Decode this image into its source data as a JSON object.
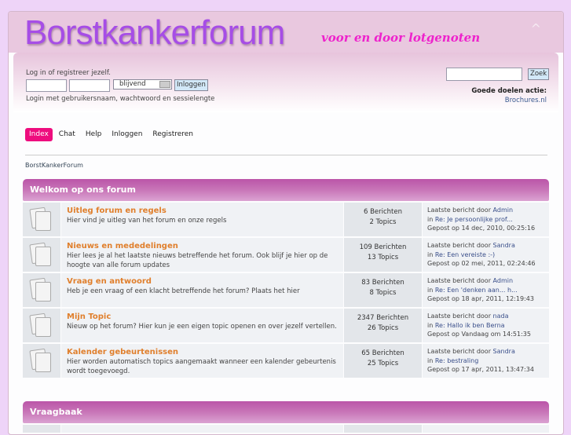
{
  "header": {
    "logo": "Borstkankerforum",
    "slogan": "voor en door lotgenoten"
  },
  "login": {
    "prompt": "Log in of registreer jezelf.",
    "session_option": "blijvend",
    "login_button": "Inloggen",
    "help": "Login met gebruikersnaam, wachtwoord en sessielengte"
  },
  "search": {
    "button": "Zoek",
    "charity_label": "Goede doelen actie:",
    "charity_link": "Brochures.nl"
  },
  "nav": [
    "Index",
    "Chat",
    "Help",
    "Inloggen",
    "Registreren"
  ],
  "breadcrumb": "BorstKankerForum",
  "categories": [
    {
      "title": "Welkom op ons forum",
      "boards": [
        {
          "name": "Uitleg forum en regels",
          "desc": "Hier vind je uitleg van het forum en onze regels",
          "posts": "6 Berichten",
          "topics": "2 Topics",
          "last_by_label": "Laatste bericht door",
          "last_by": "Admin",
          "in_label": "in",
          "last_topic": "Re: Je persoonlijke prof...",
          "date": "Gepost op 14 dec, 2010, 00:25:16"
        },
        {
          "name": "Nieuws en mededelingen",
          "desc": "Hier lees je al het laatste nieuws betreffende het forum. Ook blijf je hier op de hoogte van alle forum updates",
          "posts": "109 Berichten",
          "topics": "13 Topics",
          "last_by_label": "Laatste bericht door",
          "last_by": "Sandra",
          "in_label": "in",
          "last_topic": "Re: Een vereiste :-)",
          "date": "Gepost op 02 mei, 2011, 02:24:46"
        },
        {
          "name": "Vraag en antwoord",
          "desc": "Heb je een vraag of een klacht betreffende het forum? Plaats het hier",
          "posts": "83 Berichten",
          "topics": "8 Topics",
          "last_by_label": "Laatste bericht door",
          "last_by": "Admin",
          "in_label": "in",
          "last_topic": "Re: Een 'denken aan... h...",
          "date": "Gepost op 18 apr, 2011, 12:19:43"
        },
        {
          "name": "Mijn Topic",
          "desc": "Nieuw op het forum? Hier kun je een eigen topic openen en over jezelf vertellen.",
          "posts": "2347 Berichten",
          "topics": "26 Topics",
          "last_by_label": "Laatste bericht door",
          "last_by": "nada",
          "in_label": "in",
          "last_topic": "Re: Hallo ik ben Berna",
          "date": "Gepost op Vandaag om 14:51:35"
        },
        {
          "name": "Kalender gebeurtenissen",
          "desc": "Hier worden automatisch topics aangemaakt wanneer een kalender gebeurtenis wordt toegevoegd.",
          "posts": "65 Berichten",
          "topics": "25 Topics",
          "last_by_label": "Laatste bericht door",
          "last_by": "Sandra",
          "in_label": "in",
          "last_topic": "Re: bestraling",
          "date": "Gepost op 17 apr, 2011, 13:47:34"
        }
      ]
    },
    {
      "title": "Vraagbaak",
      "boards": []
    }
  ]
}
